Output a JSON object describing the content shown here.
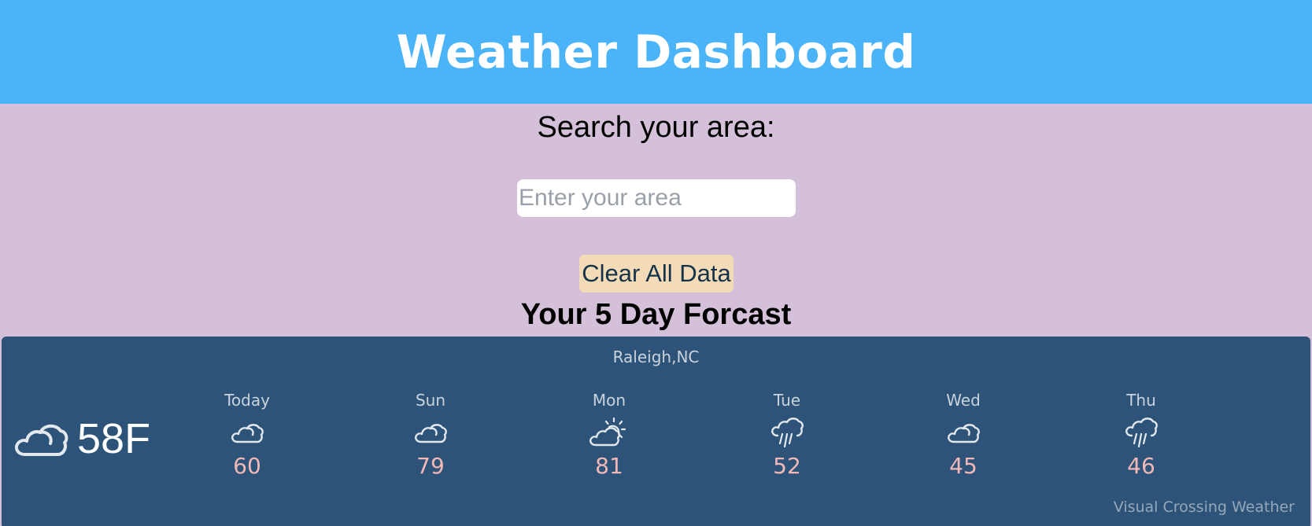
{
  "header": {
    "title": "Weather Dashboard"
  },
  "search": {
    "label": "Search your area:",
    "placeholder": "Enter your area",
    "value": ""
  },
  "clear_button": {
    "label": "Clear All Data"
  },
  "forecast": {
    "title": "Your 5 Day Forcast",
    "location": "Raleigh,NC",
    "current": {
      "icon": "cloudy-icon",
      "temp": "58F"
    },
    "days": [
      {
        "name": "Today",
        "icon": "cloudy-icon",
        "temp": "60"
      },
      {
        "name": "Sun",
        "icon": "cloudy-icon",
        "temp": "79"
      },
      {
        "name": "Mon",
        "icon": "partly-cloudy-icon",
        "temp": "81"
      },
      {
        "name": "Tue",
        "icon": "rain-icon",
        "temp": "52"
      },
      {
        "name": "Wed",
        "icon": "cloudy-icon",
        "temp": "45"
      },
      {
        "name": "Thu",
        "icon": "rain-icon",
        "temp": "46"
      }
    ],
    "credit": "Visual Crossing Weather"
  },
  "colors": {
    "header_bg": "#4bb4f9",
    "page_bg": "#d4c0d8",
    "button_bg": "#f2dbb6",
    "widget_bg": "#2d5478",
    "temp_text": "#f2b8b8"
  }
}
